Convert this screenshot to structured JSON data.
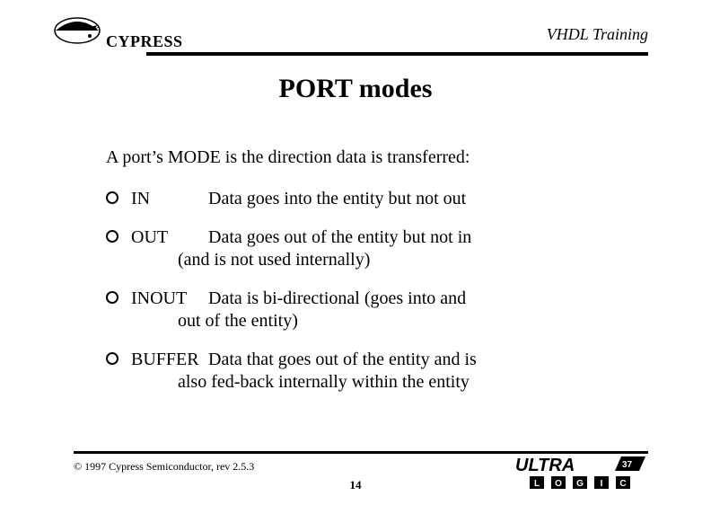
{
  "header": {
    "brand": "CYPRESS",
    "label": "VHDL Training"
  },
  "title": "PORT modes",
  "intro": "A port’s MODE is the direction data is transferred:",
  "bullets": [
    {
      "kw": "IN",
      "desc_first": "Data goes into the entity but not out",
      "cont": ""
    },
    {
      "kw": "OUT",
      "desc_first": "Data goes out of the entity but not in",
      "cont": "(and is not used internally)"
    },
    {
      "kw": "INOUT",
      "desc_first": "Data is bi-directional (goes into and",
      "cont": "out of the entity)"
    },
    {
      "kw": "BUFFER",
      "desc_first": "Data that goes out of the entity and is",
      "cont": "also fed-back internally within the entity"
    }
  ],
  "footer": {
    "copyright": "© 1997 Cypress Semiconductor, rev 2.5.3",
    "page": "14",
    "ultra": {
      "top": "ULTRA",
      "letters": [
        "L",
        "O",
        "G",
        "I",
        "C"
      ]
    }
  }
}
